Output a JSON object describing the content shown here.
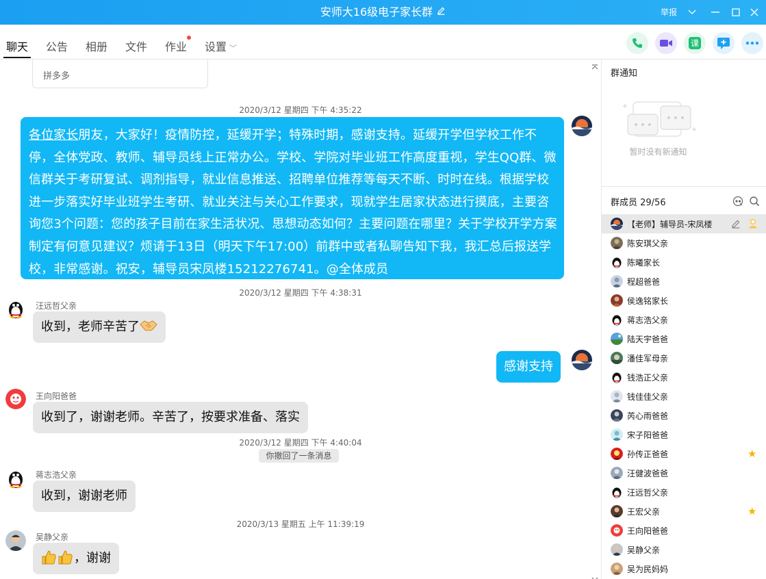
{
  "window": {
    "title": "安师大16级电子家长群",
    "report_label": "举报"
  },
  "tabs": [
    {
      "label": "聊天"
    },
    {
      "label": "公告"
    },
    {
      "label": "相册"
    },
    {
      "label": "文件"
    },
    {
      "label": "作业"
    },
    {
      "label": "设置"
    }
  ],
  "chat": {
    "card_label": "拼多多",
    "times": {
      "t1": "2020/3/12 星期四 下午 4:35:22",
      "t2": "2020/3/12 星期四 下午 4:38:31",
      "t3": "2020/3/12 星期四 下午 4:40:04",
      "t4": "2020/3/13 星期五 上午 11:39:19"
    },
    "big_message": {
      "underlined": "各位家长",
      "text": "朋友，大家好！疫情防控，延缓开学；特殊时期，感谢支持。延缓开学但学校工作不停，全体党政、教师、辅导员线上正常办公。学校、学院对毕业班工作高度重视，学生QQ群、微信群关于考研复试、调剂指导，就业信息推送、招聘单位推荐等每天不断、时时在线。根据学校进一步落实好毕业班学生考研、就业关注与关心工作要求，现就学生居家状态进行摸底，主要咨询您3个问题：您的孩子目前在家生活状况、思想动态如何？主要问题在哪里？关于学校开学方案制定有何意见建议？烦请于13日（明天下午17:00）前群中或者私聊告知下我，我汇总后报送学校，非常感谢。祝安，辅导员宋凤楼15212276741。",
      "mention": "@全体成员"
    },
    "messages": [
      {
        "sender": "汪远哲父亲",
        "text": "收到，老师辛苦了"
      },
      {
        "text": "感谢支持"
      },
      {
        "sender": "王向阳爸爸",
        "text": "收到了，谢谢老师。辛苦了，按要求准备、落实"
      },
      {
        "sender": "蒋志浩父亲",
        "text": "收到，谢谢老师"
      },
      {
        "sender": "吴静父亲",
        "text": "，谢谢"
      }
    ],
    "recall_notice": "你撤回了一条消息"
  },
  "sidebar": {
    "notice_title": "群通知",
    "notice_empty": "暂时没有新通知",
    "members_title": "群成员 29/56",
    "members": [
      {
        "name": "【老师】辅导员-宋凤楼"
      },
      {
        "name": "陈安琪父亲"
      },
      {
        "name": "陈曦家长"
      },
      {
        "name": "程超爸爸"
      },
      {
        "name": "侯逸铭家长"
      },
      {
        "name": "蒋志浩父亲"
      },
      {
        "name": "陆天宇爸爸"
      },
      {
        "name": "潘佳军母亲"
      },
      {
        "name": "钱浩正父亲"
      },
      {
        "name": "钱佳佳父亲"
      },
      {
        "name": "芮心雨爸爸"
      },
      {
        "name": "宋子阳爸爸"
      },
      {
        "name": "孙传正爸爸"
      },
      {
        "name": "汪健波爸爸"
      },
      {
        "name": "汪远哲父亲"
      },
      {
        "name": "王宏父亲"
      },
      {
        "name": "王向阳爸爸"
      },
      {
        "name": "吴静父亲"
      },
      {
        "name": "吴为民妈妈"
      }
    ]
  },
  "colors": {
    "titlebar": "#1a9ff2",
    "bubble_out": "#12b7f5",
    "bubble_in": "#e6e6e6",
    "unread_dot": "#f04848",
    "star": "#f5b500"
  }
}
